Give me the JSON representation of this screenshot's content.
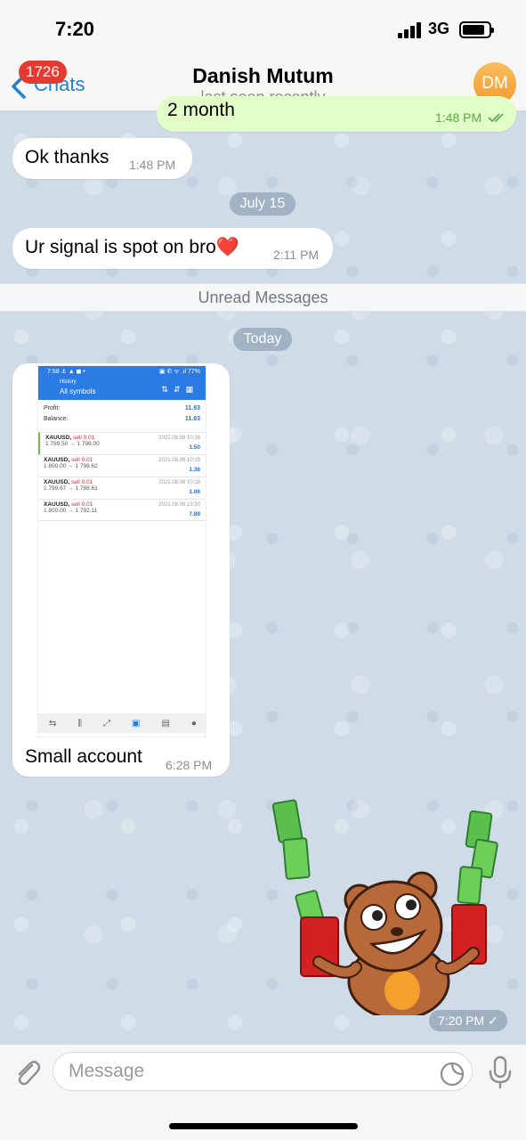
{
  "status_bar": {
    "time": "7:20",
    "network": "3G"
  },
  "header": {
    "back_label": "Chats",
    "unread_count": "1726",
    "contact_name": "Danish Mutum",
    "contact_status": "last seen recently",
    "avatar_initials": "DM"
  },
  "messages": {
    "partial_outgoing": {
      "text": "2 month",
      "time": "1:48 PM"
    },
    "msg1": {
      "text": "Ok thanks",
      "time": "1:48 PM"
    },
    "date1": "July 15",
    "msg2": {
      "text": "Ur signal is spot on bro❤️",
      "time": "2:11 PM"
    },
    "unread_label": "Unread Messages",
    "date2": "Today",
    "image_msg": {
      "caption": "Small account",
      "time": "6:28 PM",
      "screenshot": {
        "status": "7:58 ⚓ ▲ ◼ •",
        "status_right": "▣ ✆ ᯤ .ıl 77%",
        "subtitle": "History",
        "title": "All symbols",
        "profit_label": "Profit:",
        "profit_value": "11.83",
        "balance_label": "Balance:",
        "balance_value": "11.83",
        "trades": [
          {
            "symbol": "XAUUSD,",
            "side": "sell 0.01",
            "prices": "1 799.50 → 1 798.00",
            "date": "2021.08.06 10:16",
            "pl": "1.50"
          },
          {
            "symbol": "XAUUSD,",
            "side": "sell 0.01",
            "prices": "1 800.00 → 1 798.62",
            "date": "2021.08.06 10:15",
            "pl": "1.38"
          },
          {
            "symbol": "XAUUSD,",
            "side": "sell 0.01",
            "prices": "1 799.67 → 1 798.61",
            "date": "2021.08.06 10:16",
            "pl": "1.06"
          },
          {
            "symbol": "XAUUSD,",
            "side": "sell 0.01",
            "prices": "1 800.00 → 1 792.11",
            "date": "2021.08.06 15:30",
            "pl": "7.89"
          }
        ]
      }
    },
    "sticker": {
      "time": "7:20 PM"
    }
  },
  "composer": {
    "placeholder": "Message"
  },
  "colors": {
    "accent": "#2481cc",
    "badge": "#e33b32",
    "outgoing_bubble": "#e1fec6",
    "avatar": "#f49a2c"
  }
}
